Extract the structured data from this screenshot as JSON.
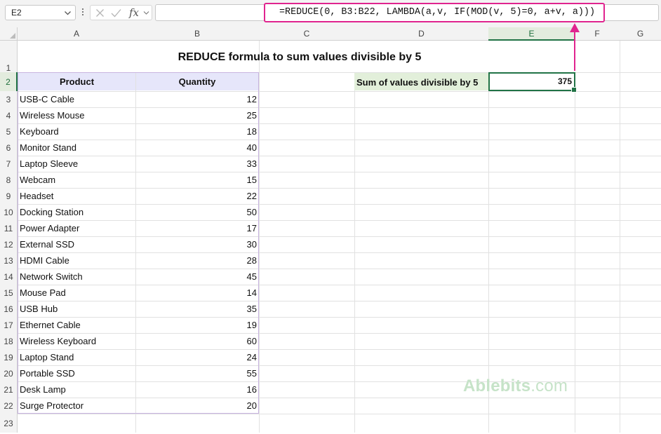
{
  "formula_bar": {
    "name_box": "E2",
    "fx": "fx",
    "formula": "=REDUCE(0, B3:B22, LAMBDA(a,v, IF(MOD(v, 5)=0, a+v, a)))"
  },
  "columns": [
    "A",
    "B",
    "C",
    "D",
    "E",
    "F",
    "G"
  ],
  "selected_column": "E",
  "rows": [
    "1",
    "2",
    "3",
    "4",
    "5",
    "6",
    "7",
    "8",
    "9",
    "10",
    "11",
    "12",
    "13",
    "14",
    "15",
    "16",
    "17",
    "18",
    "19",
    "20",
    "21",
    "22",
    "23"
  ],
  "selected_row": "2",
  "sheet": {
    "title": "REDUCE formula to sum values divisible by 5",
    "headers": {
      "product": "Product",
      "quantity": "Quantity"
    },
    "items": [
      {
        "product": "USB-C Cable",
        "quantity": "12"
      },
      {
        "product": "Wireless Mouse",
        "quantity": "25"
      },
      {
        "product": "Keyboard",
        "quantity": "18"
      },
      {
        "product": "Monitor Stand",
        "quantity": "40"
      },
      {
        "product": "Laptop Sleeve",
        "quantity": "33"
      },
      {
        "product": "Webcam",
        "quantity": "15"
      },
      {
        "product": "Headset",
        "quantity": "22"
      },
      {
        "product": "Docking Station",
        "quantity": "50"
      },
      {
        "product": "Power Adapter",
        "quantity": "17"
      },
      {
        "product": "External SSD",
        "quantity": "30"
      },
      {
        "product": "HDMI Cable",
        "quantity": "28"
      },
      {
        "product": "Network Switch",
        "quantity": "45"
      },
      {
        "product": "Mouse Pad",
        "quantity": "14"
      },
      {
        "product": "USB Hub",
        "quantity": "35"
      },
      {
        "product": "Ethernet Cable",
        "quantity": "19"
      },
      {
        "product": "Wireless Keyboard",
        "quantity": "60"
      },
      {
        "product": "Laptop Stand",
        "quantity": "24"
      },
      {
        "product": "Portable SSD",
        "quantity": "55"
      },
      {
        "product": "Desk Lamp",
        "quantity": "16"
      },
      {
        "product": "Surge Protector",
        "quantity": "20"
      }
    ],
    "result_label": "Sum of values divisible by 5",
    "result_value": "375"
  },
  "watermark": {
    "brand": "Ablebits",
    "domain": ".com"
  },
  "colors": {
    "accent_pink": "#e0248f",
    "excel_green": "#217346",
    "header_fill": "#e6e6fa",
    "label_fill": "#e2efda",
    "watermark": "#c6e3c8"
  },
  "icons": [
    "chevron-down-icon",
    "more-options-icon",
    "cancel-icon",
    "enter-icon",
    "insert-function-icon"
  ]
}
